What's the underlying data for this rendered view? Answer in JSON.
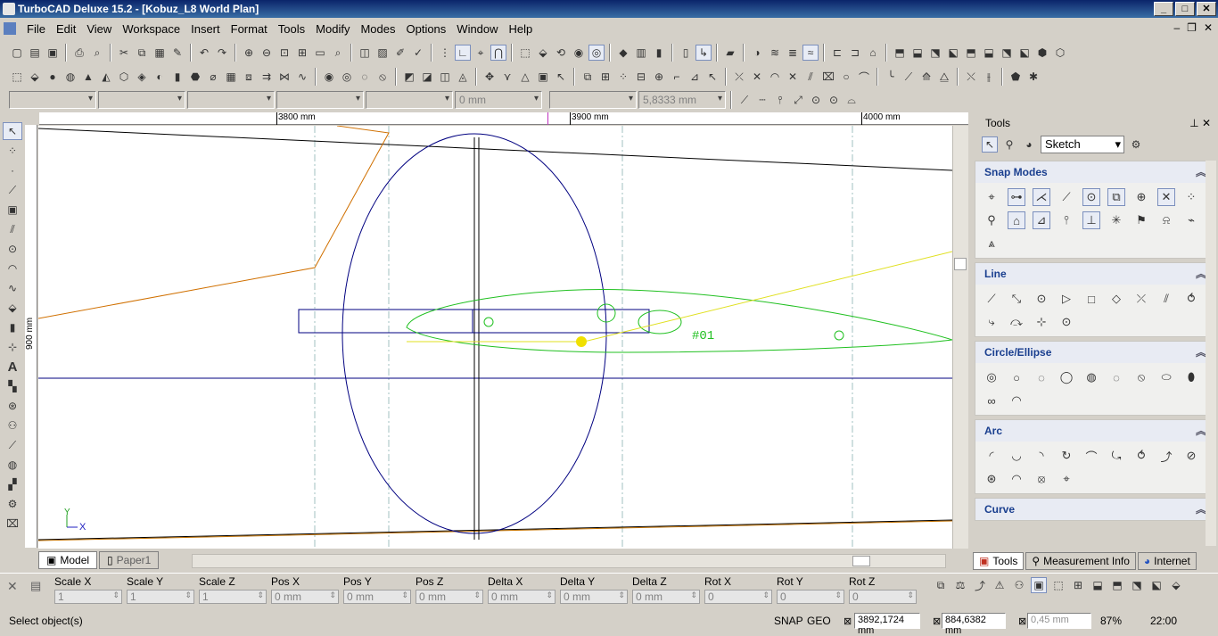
{
  "title": "TurboCAD Deluxe 15.2 - [Kobuz_L8 World Plan]",
  "menu": [
    "File",
    "Edit",
    "View",
    "Workspace",
    "Insert",
    "Format",
    "Tools",
    "Modify",
    "Modes",
    "Options",
    "Window",
    "Help"
  ],
  "property_bar": {
    "field1": "0 mm",
    "field2": "5,8333 mm"
  },
  "ruler": {
    "h": [
      "3800 mm",
      "3900 mm",
      "4000 mm"
    ],
    "v": "900 mm"
  },
  "drawing": {
    "label": "#01",
    "axis_x": "X",
    "axis_y": "Y"
  },
  "tabs": {
    "model": "Model",
    "paper": "Paper1"
  },
  "panel": {
    "title": "Tools",
    "mode": "Sketch",
    "sections": [
      {
        "title": "Snap Modes",
        "count": 19
      },
      {
        "title": "Line",
        "count": 13
      },
      {
        "title": "Circle/Ellipse",
        "count": 11
      },
      {
        "title": "Arc",
        "count": 13
      },
      {
        "title": "Curve",
        "count": 0
      }
    ],
    "tabs": [
      "Tools",
      "Measurement Info",
      "Internet"
    ]
  },
  "coords": [
    {
      "label": "Scale X",
      "value": "1"
    },
    {
      "label": "Scale Y",
      "value": "1"
    },
    {
      "label": "Scale Z",
      "value": "1"
    },
    {
      "label": "Pos X",
      "value": "0 mm"
    },
    {
      "label": "Pos Y",
      "value": "0 mm"
    },
    {
      "label": "Pos Z",
      "value": "0 mm"
    },
    {
      "label": "Delta X",
      "value": "0 mm"
    },
    {
      "label": "Delta Y",
      "value": "0 mm"
    },
    {
      "label": "Delta Z",
      "value": "0 mm"
    },
    {
      "label": "Rot X",
      "value": "0"
    },
    {
      "label": "Rot Y",
      "value": "0"
    },
    {
      "label": "Rot Z",
      "value": "0"
    }
  ],
  "status": {
    "message": "Select object(s)",
    "snap": "SNAP",
    "geo": "GEO",
    "x": "3892,1724 mm",
    "y": "884,6382 mm",
    "z": "0,45 mm",
    "zoom": "87%",
    "time": "22:00"
  }
}
